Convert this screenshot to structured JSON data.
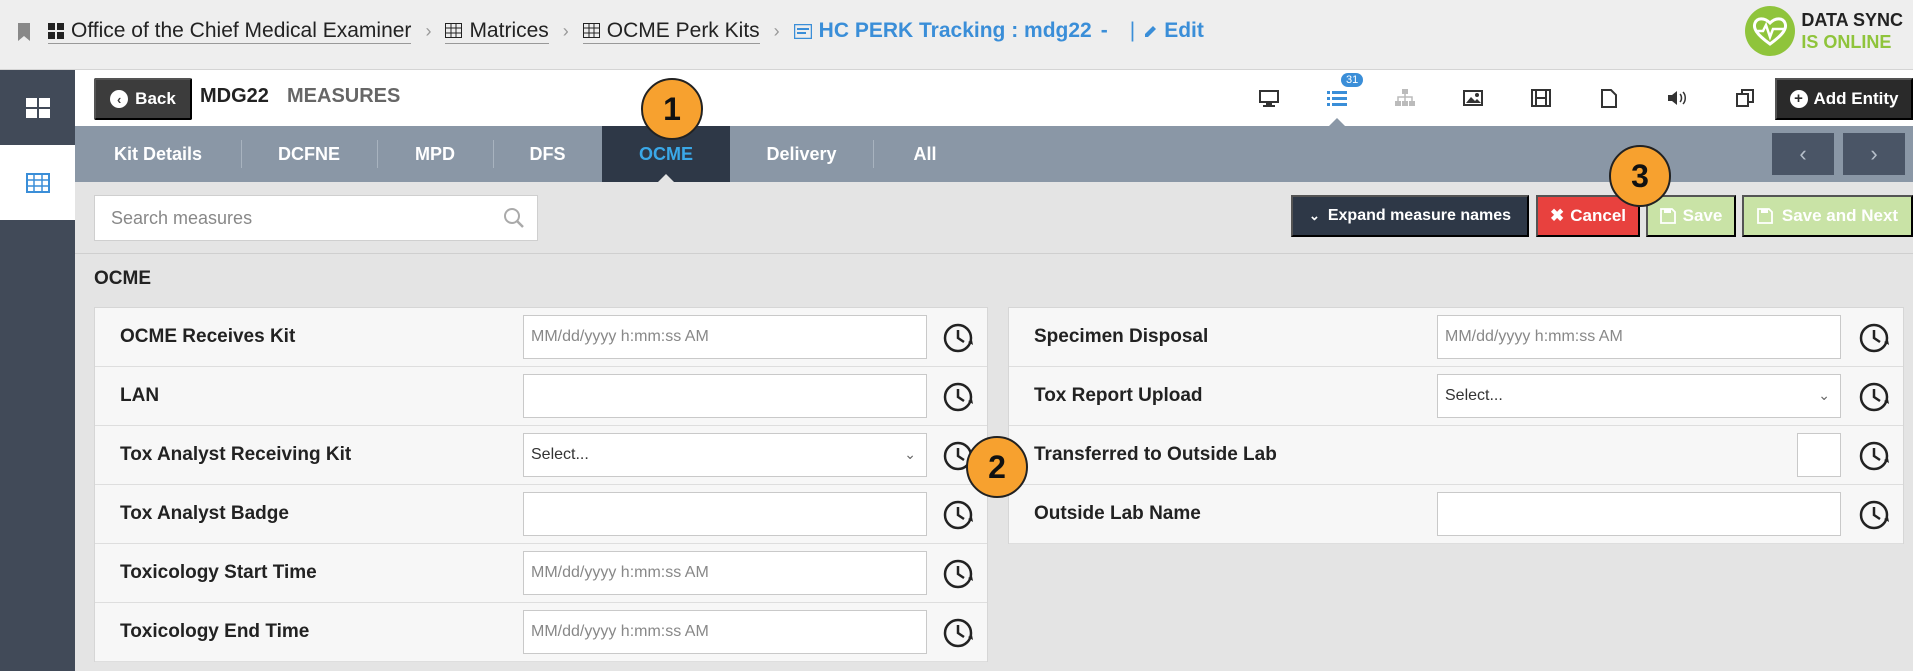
{
  "breadcrumbs": {
    "items": [
      "Office of the Chief Medical Examiner",
      "Matrices",
      "OCME Perk Kits"
    ],
    "active": "HC PERK Tracking : mdg22",
    "active_dash": "-",
    "separator": "|",
    "edit_label": "Edit"
  },
  "sync": {
    "line1": "DATA SYNC",
    "line2": "IS ONLINE",
    "color": "#8fc43b"
  },
  "header": {
    "back_label": "Back",
    "entity": "MDG22",
    "section": "MEASURES",
    "badge_count": "31",
    "add_entity_label": "Add Entity",
    "tool_icons": [
      "monitor-icon",
      "list-icon",
      "hierarchy-icon",
      "image-icon",
      "film-icon",
      "document-icon",
      "audio-icon",
      "copy-icon"
    ]
  },
  "tabs": [
    "Kit Details",
    "DCFNE",
    "MPD",
    "DFS",
    "OCME",
    "Delivery",
    "All"
  ],
  "active_tab": "OCME",
  "toolbar": {
    "search_placeholder": "Search measures",
    "expand_label": "Expand measure names",
    "cancel_label": "Cancel",
    "save_label": "Save",
    "save_next_label": "Save and Next"
  },
  "section_title": "OCME",
  "left_fields": [
    {
      "label": "OCME Receives Kit",
      "type": "datetime",
      "placeholder": "MM/dd/yyyy h:mm:ss AM"
    },
    {
      "label": "LAN",
      "type": "text",
      "placeholder": ""
    },
    {
      "label": "Tox Analyst Receiving Kit",
      "type": "select",
      "placeholder": "Select..."
    },
    {
      "label": "Tox Analyst Badge",
      "type": "text",
      "placeholder": ""
    },
    {
      "label": "Toxicology Start Time",
      "type": "datetime",
      "placeholder": "MM/dd/yyyy h:mm:ss AM"
    },
    {
      "label": "Toxicology End Time",
      "type": "datetime",
      "placeholder": "MM/dd/yyyy h:mm:ss AM"
    }
  ],
  "right_fields": [
    {
      "label": "Specimen Disposal",
      "type": "datetime",
      "placeholder": "MM/dd/yyyy h:mm:ss AM"
    },
    {
      "label": "Tox Report Upload",
      "type": "select",
      "placeholder": "Select..."
    },
    {
      "label": "Transferred to Outside Lab",
      "type": "checkbox",
      "placeholder": ""
    },
    {
      "label": "Outside Lab Name",
      "type": "text",
      "placeholder": ""
    }
  ],
  "callouts": [
    "1",
    "2",
    "3"
  ],
  "colors": {
    "accent": "#3a8ed8",
    "cancel": "#e8413e",
    "save_disabled": "#c9e3a6",
    "tab_bar": "#8a97a6",
    "callout": "#f7a12f"
  }
}
